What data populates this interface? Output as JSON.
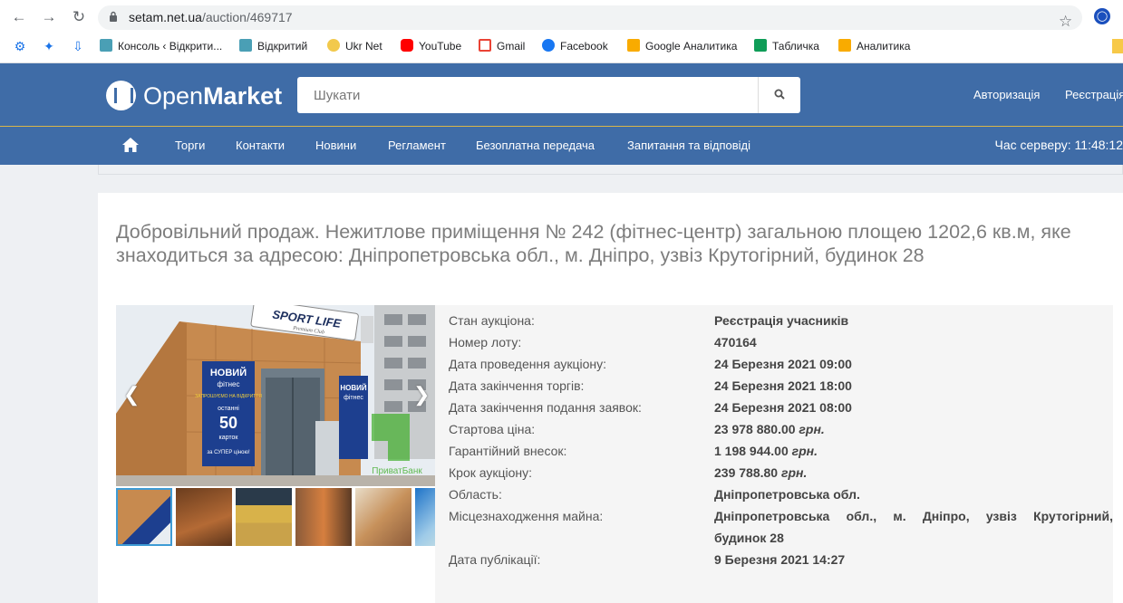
{
  "browser": {
    "url_host": "setam.net.ua",
    "url_path": "/auction/469717",
    "bookmarks": [
      "Консоль ‹ Відкрити...",
      "Відкритий",
      "Ukr Net",
      "YouTube",
      "Gmail",
      "Facebook",
      "Google Аналитика",
      "Табличка",
      "Аналитика"
    ]
  },
  "header": {
    "logo_light": "Open",
    "logo_bold": "Market",
    "search_placeholder": "Шукати",
    "login": "Авторизація",
    "register": "Реєстрація"
  },
  "nav": {
    "items": [
      "Торги",
      "Контакти",
      "Новини",
      "Регламент",
      "Безоплатна передача",
      "Запитання та відповіді"
    ],
    "server_time": "Час серверу: 11:48:12"
  },
  "auction": {
    "title": "Добровільний продаж. Нежитлове приміщення № 242 (фітнес-центр) загальною площею 1202,6 кв.м, яке знаходиться за адресою: Дніпропетровська обл., м. Дніпро, узвіз Крутогірний, будинок 28",
    "photo": {
      "sign_top": "SPORT LIFE",
      "sign_sub": "Premium Club",
      "banner_left": [
        "НОВИЙ",
        "фітнес",
        "ЗАПРОШУЄМО НА ВІДКРИТТЯ",
        "останні",
        "50",
        "карток",
        "за СУПЕР ціною!"
      ],
      "banner_right": [
        "НОВИЙ",
        "фітнес"
      ],
      "watermark": "ПриватБанк"
    },
    "fields": [
      {
        "label": "Стан аукціона:",
        "value": "Реєстрація учасників"
      },
      {
        "label": "Номер лоту:",
        "value": "470164"
      },
      {
        "label": "Дата проведення аукціону:",
        "value": "24 Березня 2021 09:00"
      },
      {
        "label": "Дата закінчення торгів:",
        "value": "24 Березня 2021 18:00"
      },
      {
        "label": "Дата закінчення подання заявок:",
        "value": "24 Березня 2021 08:00"
      },
      {
        "label": "Стартова ціна:",
        "value": "23 978 880.00",
        "unit": "грн."
      },
      {
        "label": "Гарантійний внесок:",
        "value": "1 198 944.00",
        "unit": "грн."
      },
      {
        "label": "Крок аукціону:",
        "value": "239 788.80",
        "unit": "грн."
      },
      {
        "label": "Область:",
        "value": "Дніпропетровська обл."
      },
      {
        "label": "Місцезнаходження майна:",
        "value": "Дніпропетровська обл., м. Дніпро, узвіз Крутогірний,",
        "value2": "будинок 28"
      },
      {
        "label": "Дата публікації:",
        "value": "9 Березня 2021 14:27"
      }
    ]
  }
}
